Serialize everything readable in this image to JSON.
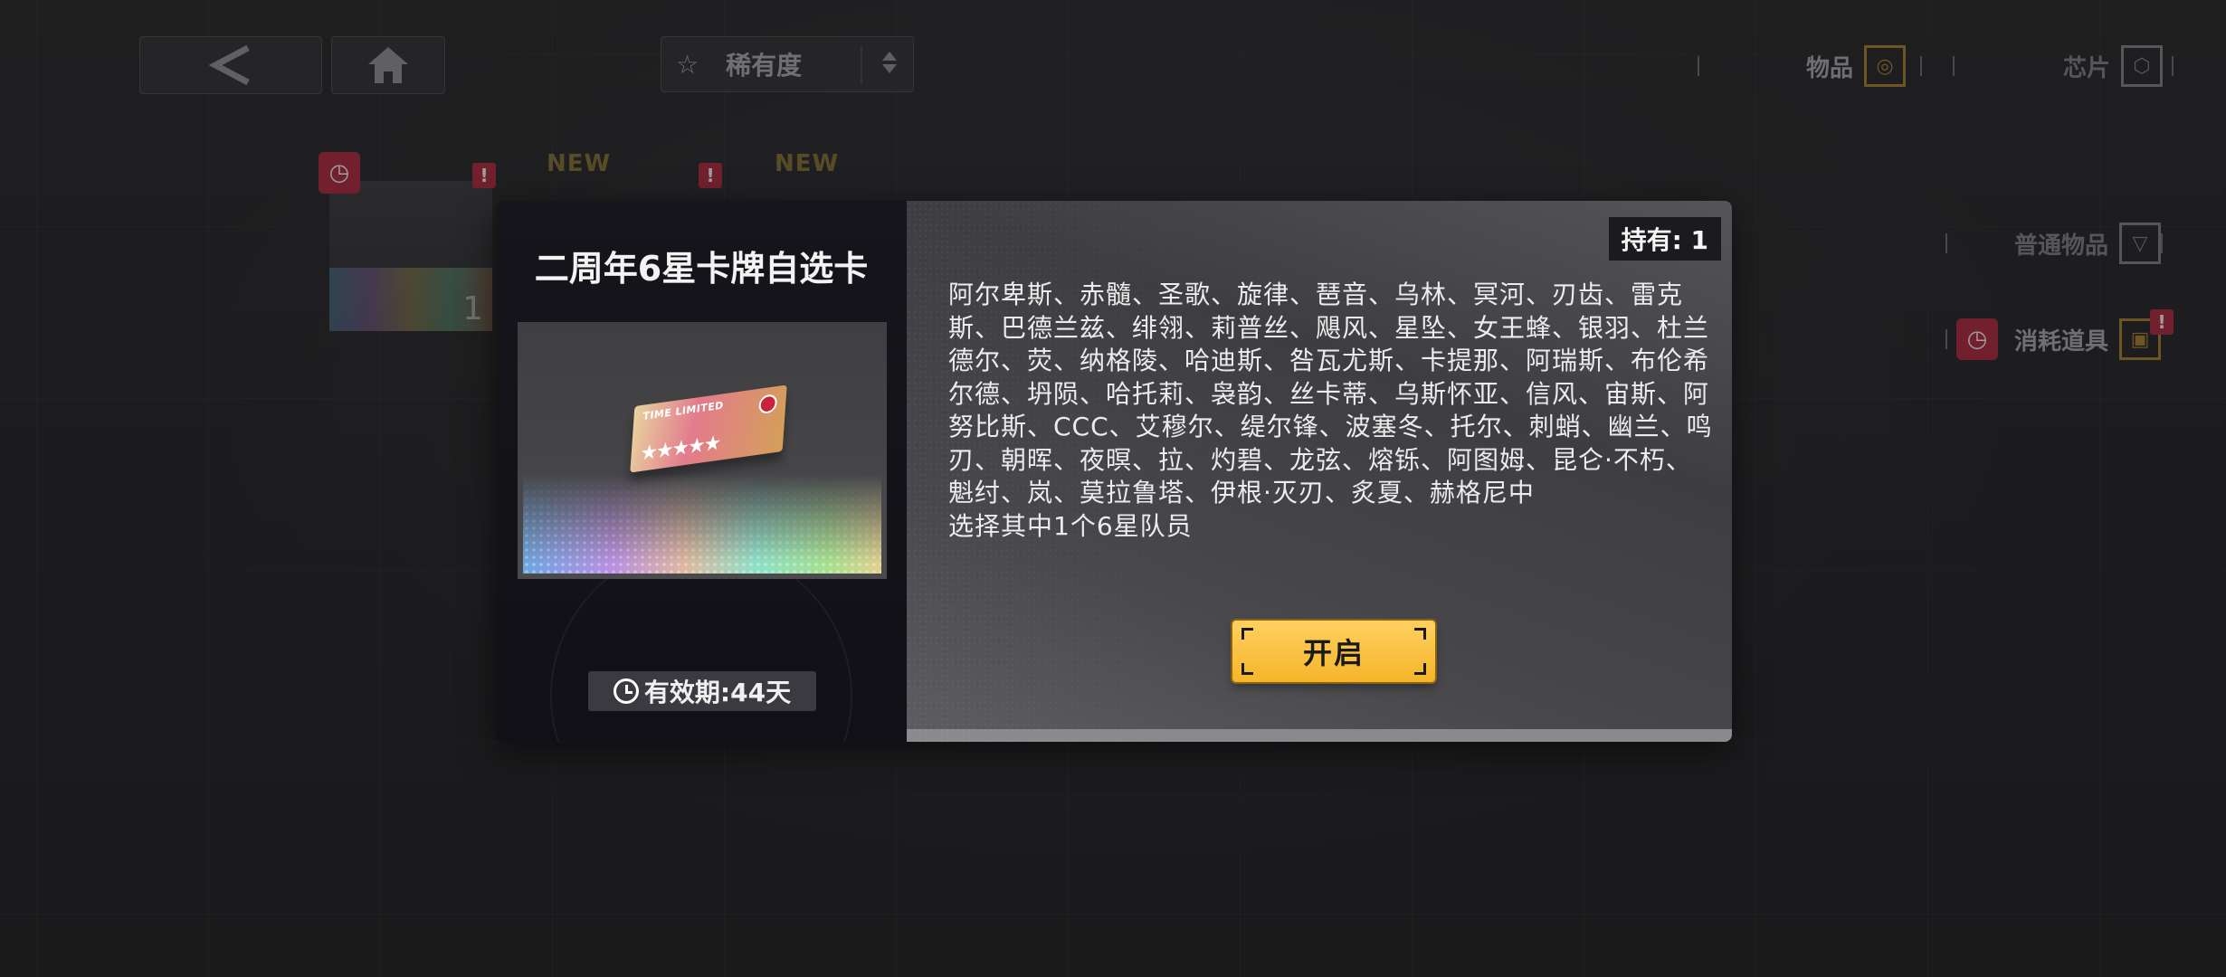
{
  "topbar": {
    "back_icon": "chevron-left-icon",
    "home_icon": "home-icon",
    "sort_label": "稀有度",
    "sort_icon": "star-outline-icon"
  },
  "tabs": {
    "items": "物品",
    "chips": "芯片",
    "normal": "普通物品",
    "consumable": "消耗道具"
  },
  "badges": {
    "new1": "NEW",
    "new2": "NEW",
    "excl": "!"
  },
  "grid_item": {
    "count": "1"
  },
  "dialog": {
    "title": "二周年6星卡牌自选卡",
    "owned": "持有: 1",
    "validity": "有效期:44天",
    "description": "阿尔卑斯、赤髓、圣歌、旋律、琶音、乌林、冥河、刃齿、雷克斯、巴德兰兹、绯翎、莉普丝、飓风、星坠、女王蜂、银羽、杜兰德尔、荧、纳格陵、哈迪斯、咎瓦尤斯、卡提那、阿瑞斯、布伦希尔德、坍陨、哈托莉、袅韵、丝卡蒂、乌斯怀亚、信风、宙斯、阿努比斯、CCC、艾穆尔、缇尔锋、波塞冬、托尔、刺蛸、幽兰、鸣刃、朝晖、夜暝、拉、灼碧、龙弦、熔铄、阿图姆、昆仑·不朽、魁纣、岚、莫拉鲁塔、伊根·灭刃、炙夏、赫格尼中",
    "description_line2": "选择其中1个6星队员",
    "open_button": "开启",
    "ticket_text": "TIME LIMITED"
  },
  "colors": {
    "accent_gold": "#f5b52a",
    "badge_red": "#b8344b",
    "new_gold": "#8f7a3c"
  }
}
